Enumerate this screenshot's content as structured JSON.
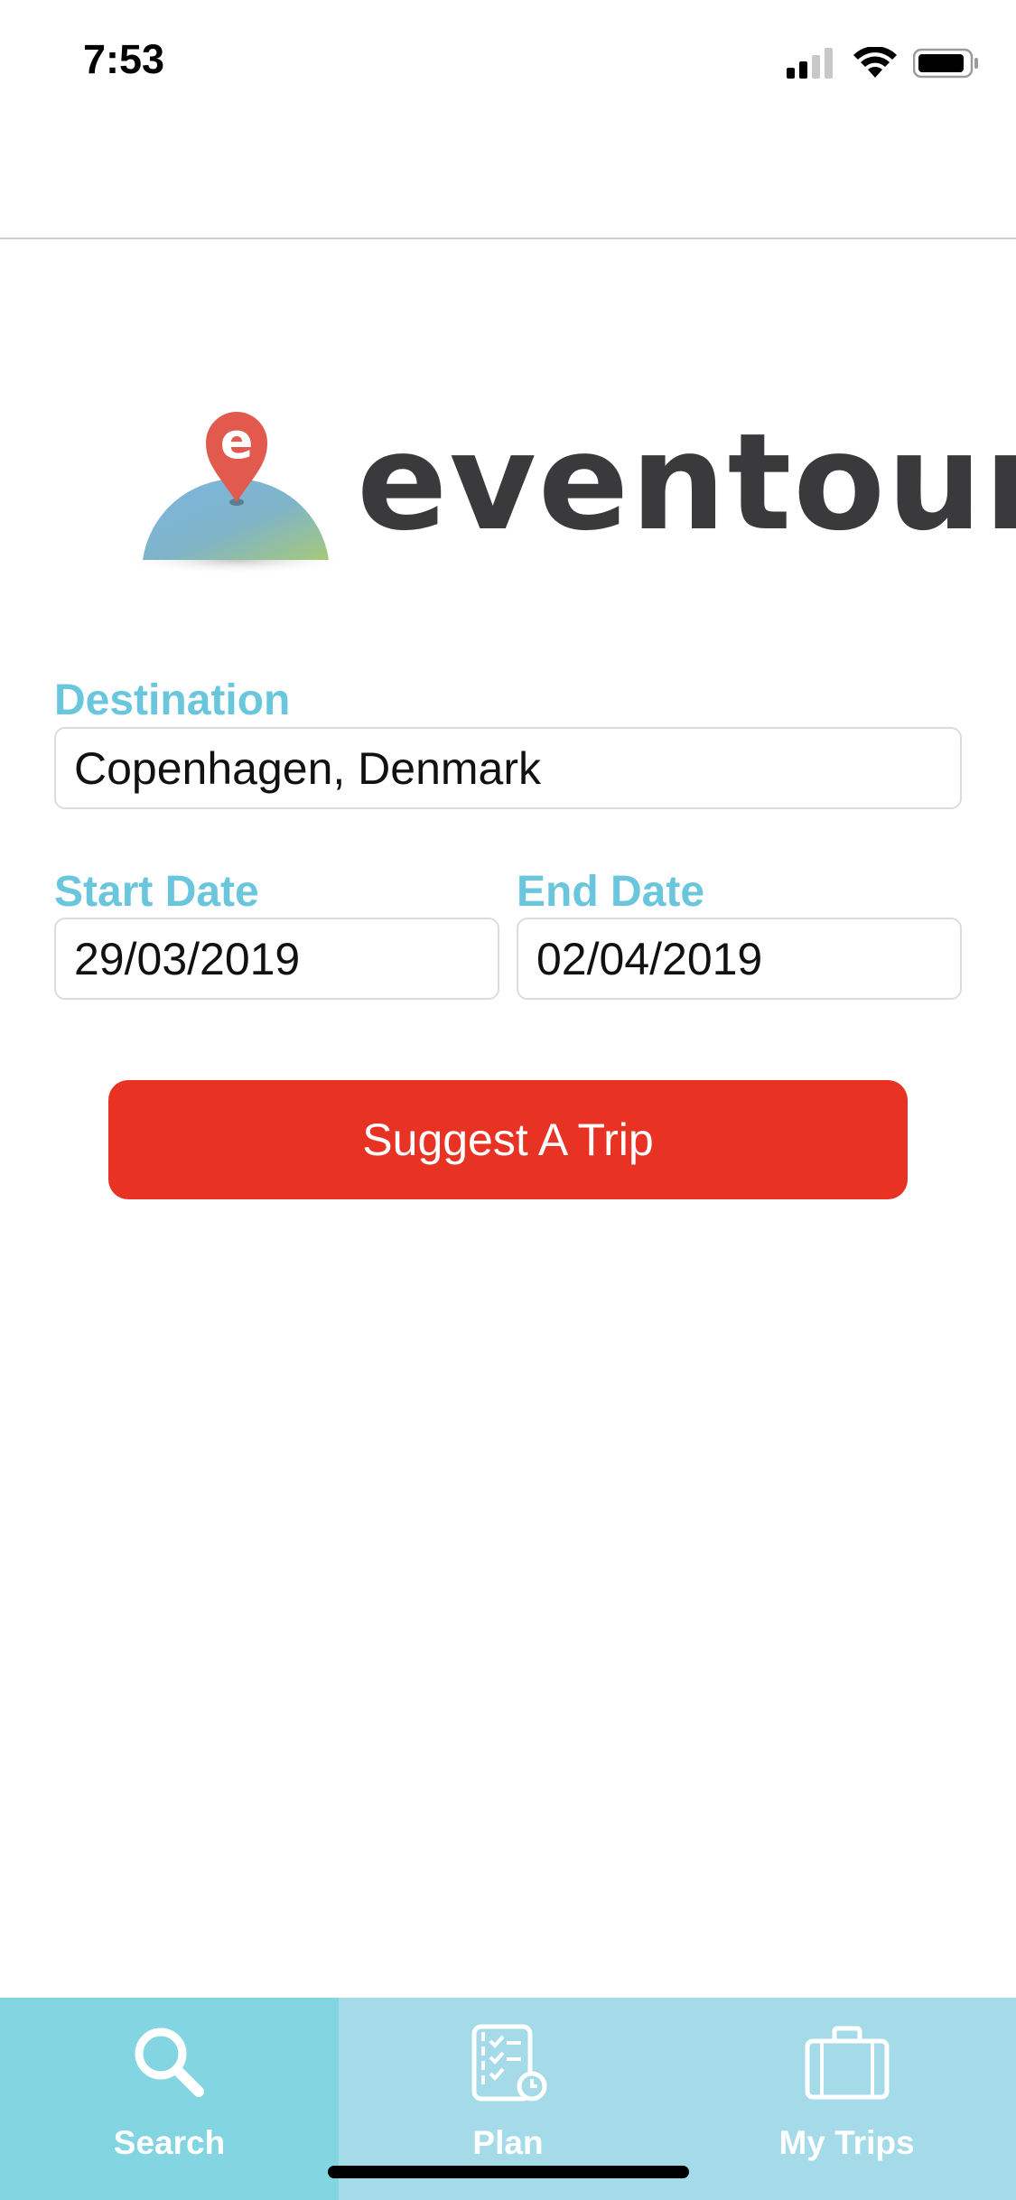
{
  "status_bar": {
    "time": "7:53"
  },
  "brand": {
    "name": "eventour",
    "pin_letter": "e"
  },
  "form": {
    "destination": {
      "label": "Destination",
      "value": "Copenhagen, Denmark"
    },
    "start_date": {
      "label": "Start Date",
      "value": "29/03/2019"
    },
    "end_date": {
      "label": "End Date",
      "value": "02/04/2019"
    },
    "submit_label": "Suggest A Trip"
  },
  "tabs": [
    {
      "label": "Search",
      "icon": "search-icon",
      "active": true
    },
    {
      "label": "Plan",
      "icon": "checklist-icon",
      "active": false
    },
    {
      "label": "My Trips",
      "icon": "suitcase-icon",
      "active": false
    }
  ],
  "colors": {
    "accent_label": "#6ac6dd",
    "button": "#e83224",
    "tab_bar": "#a5dbe9",
    "tab_active": "#84d5e2"
  }
}
